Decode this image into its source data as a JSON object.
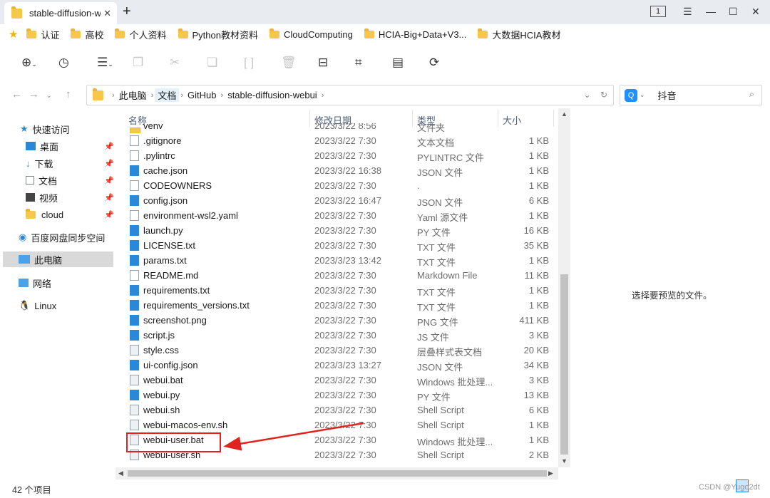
{
  "tab": {
    "title": "stable-diffusion-webui",
    "close": "✕",
    "new": "+"
  },
  "window": {
    "badge": "1"
  },
  "bookmarks": [
    "认证",
    "高校",
    "个人资料",
    "Python教材资料",
    "CloudComputing",
    "HCIA-Big+Data+V3...",
    "大数据HCIA教材"
  ],
  "breadcrumb": [
    "此电脑",
    "文档",
    "GitHub",
    "stable-diffusion-webui"
  ],
  "search": {
    "engine_label": "Q",
    "text": "抖音"
  },
  "sidebar": {
    "quick_access": "快速访问",
    "items": [
      {
        "label": "桌面"
      },
      {
        "label": "下载"
      },
      {
        "label": "文档"
      },
      {
        "label": "视频"
      },
      {
        "label": "cloud"
      }
    ],
    "baidu": "百度网盘同步空间",
    "this_pc": "此电脑",
    "network": "网络",
    "linux": "Linux"
  },
  "columns": {
    "name": "名称",
    "date": "修改日期",
    "type": "类型",
    "size": "大小"
  },
  "files": [
    {
      "name": "venv",
      "date": "2023/3/22 8:56",
      "type": "文件夹",
      "size": "",
      "icon": "folder"
    },
    {
      "name": ".gitignore",
      "date": "2023/3/22 7:30",
      "type": "文本文档",
      "size": "1 KB",
      "icon": "doc"
    },
    {
      "name": ".pylintrc",
      "date": "2023/3/22 7:30",
      "type": "PYLINTRC 文件",
      "size": "1 KB",
      "icon": "doc"
    },
    {
      "name": "cache.json",
      "date": "2023/3/22 16:38",
      "type": "JSON 文件",
      "size": "1 KB",
      "icon": "blue"
    },
    {
      "name": "CODEOWNERS",
      "date": "2023/3/22 7:30",
      "type": ".",
      "size": "1 KB",
      "icon": "doc"
    },
    {
      "name": "config.json",
      "date": "2023/3/22 16:47",
      "type": "JSON 文件",
      "size": "6 KB",
      "icon": "blue"
    },
    {
      "name": "environment-wsl2.yaml",
      "date": "2023/3/22 7:30",
      "type": "Yaml 源文件",
      "size": "1 KB",
      "icon": "doc"
    },
    {
      "name": "launch.py",
      "date": "2023/3/22 7:30",
      "type": "PY 文件",
      "size": "16 KB",
      "icon": "blue"
    },
    {
      "name": "LICENSE.txt",
      "date": "2023/3/22 7:30",
      "type": "TXT 文件",
      "size": "35 KB",
      "icon": "blue"
    },
    {
      "name": "params.txt",
      "date": "2023/3/23 13:42",
      "type": "TXT 文件",
      "size": "1 KB",
      "icon": "blue"
    },
    {
      "name": "README.md",
      "date": "2023/3/22 7:30",
      "type": "Markdown File",
      "size": "11 KB",
      "icon": "doc"
    },
    {
      "name": "requirements.txt",
      "date": "2023/3/22 7:30",
      "type": "TXT 文件",
      "size": "1 KB",
      "icon": "blue"
    },
    {
      "name": "requirements_versions.txt",
      "date": "2023/3/22 7:30",
      "type": "TXT 文件",
      "size": "1 KB",
      "icon": "blue"
    },
    {
      "name": "screenshot.png",
      "date": "2023/3/22 7:30",
      "type": "PNG 文件",
      "size": "411 KB",
      "icon": "blue"
    },
    {
      "name": "script.js",
      "date": "2023/3/22 7:30",
      "type": "JS 文件",
      "size": "3 KB",
      "icon": "blue"
    },
    {
      "name": "style.css",
      "date": "2023/3/22 7:30",
      "type": "层叠样式表文档",
      "size": "20 KB",
      "icon": "gear"
    },
    {
      "name": "ui-config.json",
      "date": "2023/3/23 13:27",
      "type": "JSON 文件",
      "size": "34 KB",
      "icon": "blue"
    },
    {
      "name": "webui.bat",
      "date": "2023/3/22 7:30",
      "type": "Windows 批处理...",
      "size": "3 KB",
      "icon": "gear"
    },
    {
      "name": "webui.py",
      "date": "2023/3/22 7:30",
      "type": "PY 文件",
      "size": "13 KB",
      "icon": "blue"
    },
    {
      "name": "webui.sh",
      "date": "2023/3/22 7:30",
      "type": "Shell Script",
      "size": "6 KB",
      "icon": "gear"
    },
    {
      "name": "webui-macos-env.sh",
      "date": "2023/3/22 7:30",
      "type": "Shell Script",
      "size": "1 KB",
      "icon": "gear"
    },
    {
      "name": "webui-user.bat",
      "date": "2023/3/22 7:30",
      "type": "Windows 批处理...",
      "size": "1 KB",
      "icon": "gear"
    },
    {
      "name": "webui-user.sh",
      "date": "2023/3/22 7:30",
      "type": "Shell Script",
      "size": "2 KB",
      "icon": "gear"
    }
  ],
  "preview": {
    "text": "选择要预览的文件。"
  },
  "status": {
    "count": "42 个项目"
  },
  "watermark": "CSDN @Yugo2dt",
  "colors": {
    "highlight": "#e0231e",
    "accent": "#2b88d8",
    "folder": "#f5c84c"
  }
}
